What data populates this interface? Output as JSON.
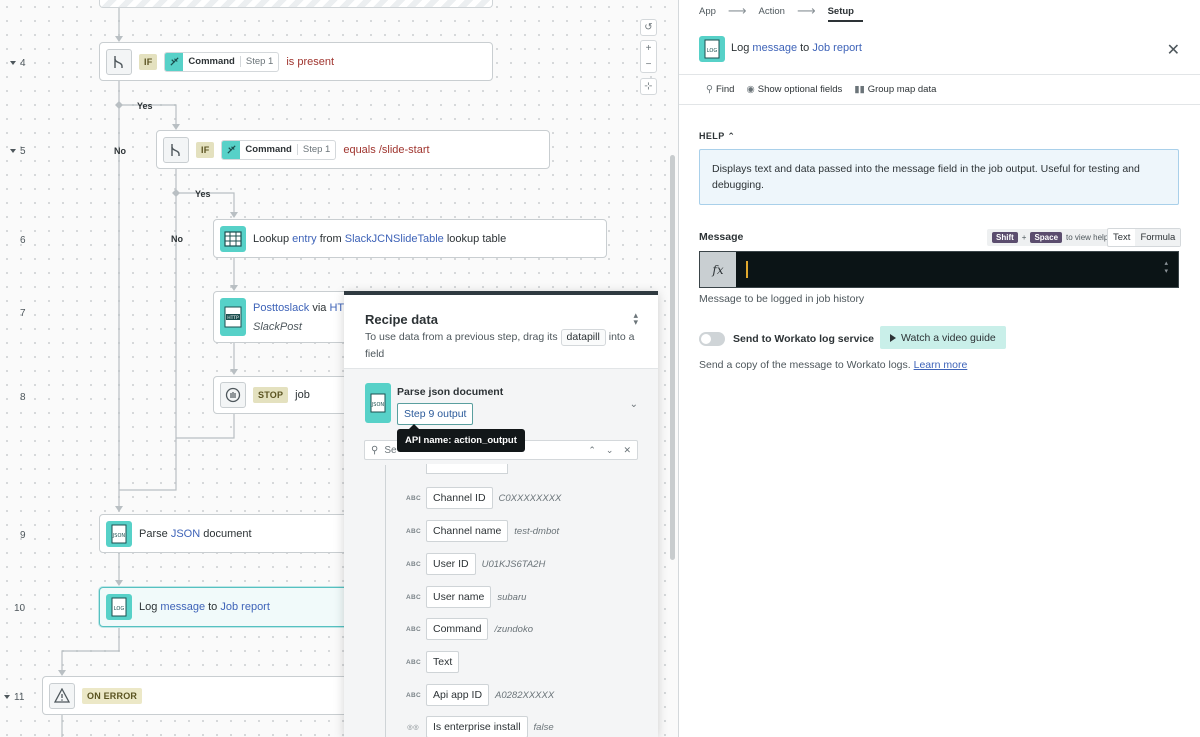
{
  "canvas": {
    "line_numbers": [
      "4",
      "5",
      "6",
      "7",
      "8",
      "9",
      "10",
      "11"
    ],
    "branch_labels": {
      "yes": "Yes",
      "no": "No"
    },
    "steps": {
      "s4": {
        "tag": "IF",
        "pill_name": "Command",
        "pill_step": "Step 1",
        "condition": "is present"
      },
      "s5": {
        "tag": "IF",
        "pill_name": "Command",
        "pill_step": "Step 1",
        "condition": "equals",
        "value": "/slide-start"
      },
      "s6": {
        "pre": "Lookup",
        "link1": "entry",
        "mid": "from",
        "link2": "SlackJCNSlideTable",
        "post": "lookup table"
      },
      "s7": {
        "link": "Posttoslack",
        "mid": "via",
        "link2": "HT",
        "sub": "SlackPost"
      },
      "s8": {
        "tag": "STOP",
        "text": "job"
      },
      "s9": {
        "pre": "Parse",
        "link": "JSON",
        "post": "document"
      },
      "s10": {
        "pre": "Log",
        "link1": "message",
        "mid": "to",
        "link2": "Job report"
      },
      "s11": {
        "tag": "ON ERROR"
      }
    },
    "zoom": {
      "reset": "↺",
      "plus": "+",
      "minus": "−",
      "fit": "⊹"
    }
  },
  "recipe_data": {
    "title": "Recipe data",
    "desc_pre": "To use data from a previous step, drag its",
    "desc_chip": "datapill",
    "desc_post": "into a field",
    "source": {
      "title": "Parse json document",
      "step": "Step 9 output",
      "tooltip": "API name: action_output"
    },
    "search_placeholder": "Se",
    "fields": [
      {
        "type": "ABC",
        "name": "Channel ID",
        "sample": "C0XXXXXXXX"
      },
      {
        "type": "ABC",
        "name": "Channel name",
        "sample": "test-dmbot"
      },
      {
        "type": "ABC",
        "name": "User ID",
        "sample": "U01KJS6TA2H"
      },
      {
        "type": "ABC",
        "name": "User name",
        "sample": "subaru"
      },
      {
        "type": "ABC",
        "name": "Command",
        "sample": "/zundoko"
      },
      {
        "type": "ABC",
        "name": "Text",
        "sample": ""
      },
      {
        "type": "ABC",
        "name": "Api app ID",
        "sample": "A0282XXXXX"
      },
      {
        "type": "◎◎",
        "name": "Is enterprise install",
        "sample": "false"
      }
    ]
  },
  "setup": {
    "wizard": {
      "app": "App",
      "action": "Action",
      "setup": "Setup",
      "arrow": "⟶"
    },
    "header": {
      "pre": "Log",
      "link1": "message",
      "mid": "to",
      "link2": "Job report",
      "close": "✕"
    },
    "toolbar": {
      "find": "Find",
      "optional": "Show optional fields",
      "group": "Group map data"
    },
    "help": {
      "label": "HELP",
      "text": "Displays text and data passed into the message field in the job output. Useful for testing and debugging."
    },
    "message": {
      "label": "Message",
      "kbd1": "Shift",
      "plus": "+",
      "kbd2": "Space",
      "kbd_hint": "to view help",
      "mode_text": "Text",
      "mode_formula": "Formula",
      "fx": "fx",
      "hint": "Message to be logged in job history"
    },
    "log_service": {
      "label": "Send to Workato log service",
      "video": "Watch a video guide",
      "desc": "Send a copy of the message to Workato logs.",
      "learn_more": "Learn more"
    }
  }
}
